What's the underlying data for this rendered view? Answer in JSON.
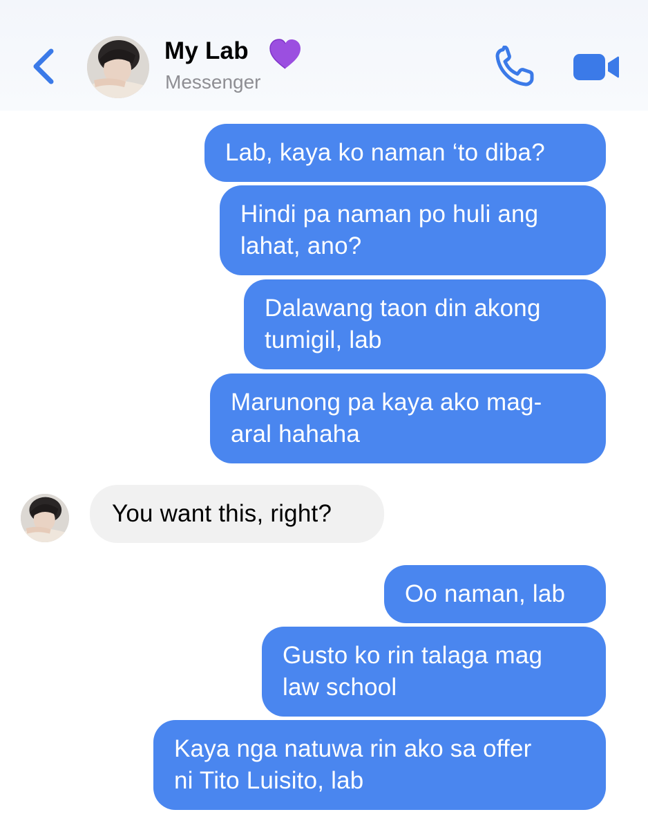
{
  "header": {
    "back_icon": "chevron-left-icon",
    "contact_name": "My Lab",
    "name_emoji": "purple-heart-icon",
    "subtitle": "Messenger",
    "call_icon": "phone-icon",
    "video_icon": "video-camera-icon",
    "accent_color": "#3b7ae8"
  },
  "messages": [
    {
      "direction": "outgoing",
      "lines": [
        "Lab, kaya ko naman ‘to diba?"
      ]
    },
    {
      "direction": "outgoing",
      "lines": [
        "Hindi pa naman po huli ang",
        "lahat, ano?"
      ]
    },
    {
      "direction": "outgoing",
      "lines": [
        "Dalawang taon din akong",
        "tumigil, lab"
      ]
    },
    {
      "direction": "outgoing",
      "lines": [
        "Marunong pa kaya ako mag-",
        "aral hahaha"
      ]
    },
    {
      "direction": "incoming",
      "lines": [
        "You want this, right?"
      ]
    },
    {
      "direction": "outgoing",
      "lines": [
        "Oo naman, lab"
      ]
    },
    {
      "direction": "outgoing",
      "lines": [
        "Gusto ko rin talaga mag",
        "law school"
      ]
    },
    {
      "direction": "outgoing",
      "lines": [
        "Kaya nga natuwa rin ako sa offer",
        "ni Tito Luisito, lab"
      ]
    }
  ],
  "colors": {
    "outgoing_bubble": "#4a86ef",
    "incoming_bubble": "#f1f1f1",
    "outgoing_text": "#ffffff",
    "incoming_text": "#000000"
  }
}
